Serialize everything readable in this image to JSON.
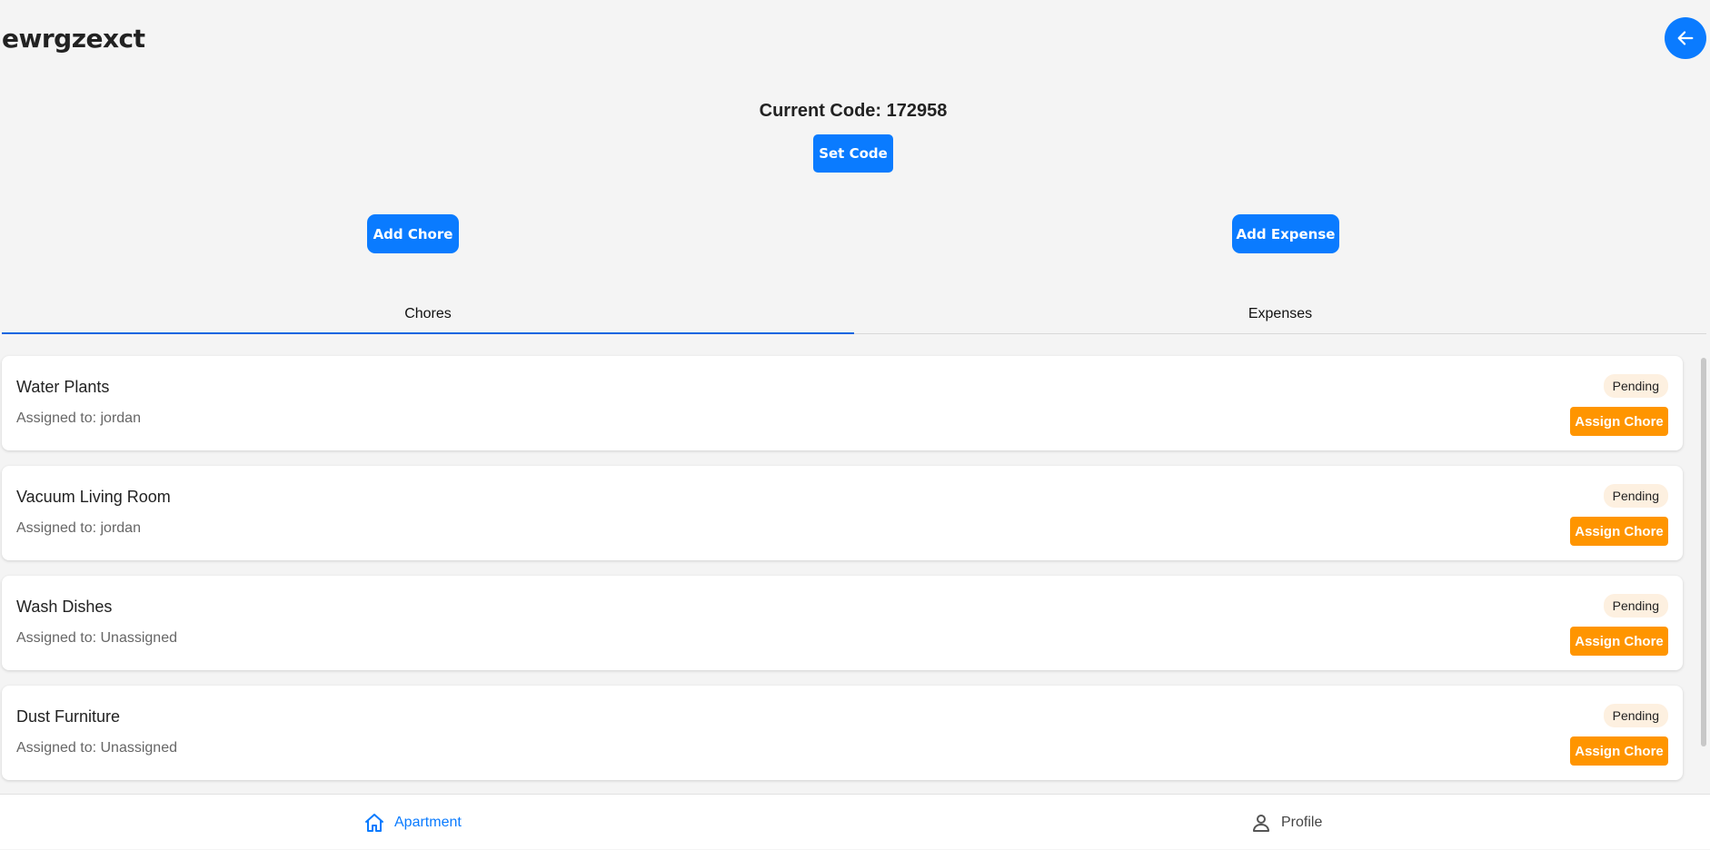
{
  "header": {
    "title": "ewrgzexct",
    "back_icon": "arrow-left-icon"
  },
  "code": {
    "label": "Current Code: 172958",
    "set_button": "Set Code"
  },
  "actions": {
    "add_chore": "Add Chore",
    "add_expense": "Add Expense"
  },
  "tabs": [
    {
      "label": "Chores",
      "active": true
    },
    {
      "label": "Expenses",
      "active": false
    }
  ],
  "chores": [
    {
      "title": "Water Plants",
      "assigned": "Assigned to: jordan",
      "status": "Pending",
      "action": "Assign Chore"
    },
    {
      "title": "Vacuum Living Room",
      "assigned": "Assigned to: jordan",
      "status": "Pending",
      "action": "Assign Chore"
    },
    {
      "title": "Wash Dishes",
      "assigned": "Assigned to: Unassigned",
      "status": "Pending",
      "action": "Assign Chore"
    },
    {
      "title": "Dust Furniture",
      "assigned": "Assigned to: Unassigned",
      "status": "Pending",
      "action": "Assign Chore"
    }
  ],
  "bottom_nav": [
    {
      "label": "Apartment",
      "icon": "home-icon",
      "active": true
    },
    {
      "label": "Profile",
      "icon": "user-icon",
      "active": false
    }
  ],
  "colors": {
    "primary": "#0a7bff",
    "accent": "#ff9500",
    "badge_bg": "#fdf0e0",
    "background": "#f4f4f4"
  }
}
